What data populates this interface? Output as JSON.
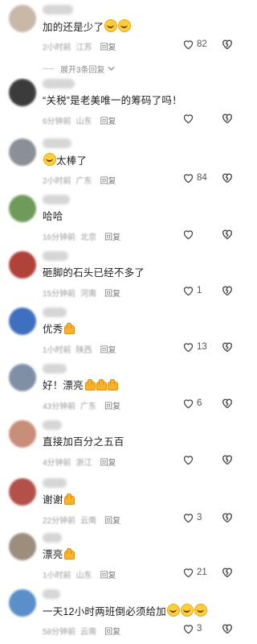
{
  "comments": [
    {
      "text": "加的还是少了",
      "emoji": "grin-squint-icon",
      "emoji_count": 2,
      "thumb_count": 0,
      "time": "2小时前",
      "location": "江苏",
      "reply_label": "回复",
      "likes": "82",
      "expand_label": "展开3条回复",
      "avatar_color": "#c9b8a8"
    },
    {
      "text": "“关税”是老美唯一的筹码了吗！",
      "emoji": "",
      "emoji_count": 0,
      "thumb_count": 0,
      "time": "6分钟前",
      "location": "山东",
      "reply_label": "回复",
      "likes": "",
      "avatar_color": "#3b3b3b"
    },
    {
      "text": "太棒了",
      "emoji": "grin-squint-icon",
      "emoji_count": 1,
      "emoji_first": true,
      "thumb_count": 0,
      "time": "2小时前",
      "location": "广东",
      "reply_label": "回复",
      "likes": "84",
      "avatar_color": "#8a8f98"
    },
    {
      "text": "哈哈",
      "emoji": "",
      "emoji_count": 0,
      "thumb_count": 0,
      "time": "16分钟前",
      "location": "北京",
      "reply_label": "回复",
      "likes": "",
      "avatar_color": "#6f9a5a"
    },
    {
      "text": "砸脚的石头已经不多了",
      "emoji": "",
      "emoji_count": 0,
      "thumb_count": 0,
      "time": "15分钟前",
      "location": "河南",
      "reply_label": "回复",
      "likes": "1",
      "avatar_color": "#b0423a"
    },
    {
      "text": "优秀",
      "emoji": "thumbs-up-icon",
      "emoji_count": 0,
      "thumb_count": 1,
      "time": "1小时前",
      "location": "陕西",
      "reply_label": "回复",
      "likes": "13",
      "avatar_color": "#3f6fbf"
    },
    {
      "text": "好！漂亮",
      "emoji": "thumbs-up-icon",
      "emoji_count": 0,
      "thumb_count": 3,
      "time": "43分钟前",
      "location": "广东",
      "reply_label": "回复",
      "likes": "6",
      "avatar_color": "#7f8fa6"
    },
    {
      "text": "直接加百分之五百",
      "emoji": "",
      "emoji_count": 0,
      "thumb_count": 0,
      "time": "4分钟前",
      "location": "浙江",
      "reply_label": "回复",
      "likes": "",
      "avatar_color": "#c88e7a"
    },
    {
      "text": "谢谢",
      "emoji": "thumbs-up-icon",
      "emoji_count": 0,
      "thumb_count": 1,
      "time": "22分钟前",
      "location": "云南",
      "reply_label": "回复",
      "likes": "3",
      "avatar_color": "#b3504a"
    },
    {
      "text": "漂亮",
      "emoji": "thumbs-up-icon",
      "emoji_count": 0,
      "thumb_count": 1,
      "time": "1小时前",
      "location": "山东",
      "reply_label": "回复",
      "likes": "21",
      "avatar_color": "#9c8d7c"
    },
    {
      "text": "一天12小时两班倒必须给加",
      "emoji": "grin-squint-icon",
      "emoji_count": 3,
      "thumb_count": 0,
      "time": "58分钟前",
      "location": "云南",
      "reply_label": "回复",
      "likes": "3",
      "avatar_color": "#5a8fc9"
    }
  ],
  "colors": {
    "accent": "#ffce3a",
    "meta": "#9a9a9a"
  }
}
